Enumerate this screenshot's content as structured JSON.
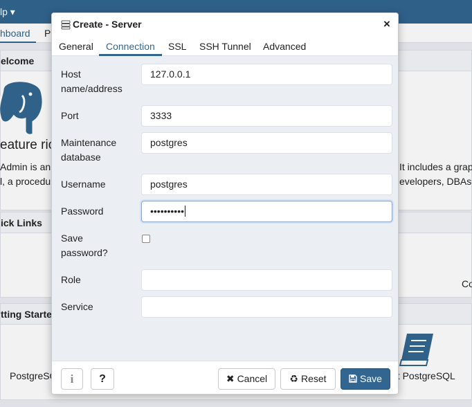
{
  "background": {
    "menu_label": "lp",
    "menu_chevron_icon": "chevron-down-icon",
    "tab_active": "hboard",
    "tab_other": "Pr",
    "welcome_head": "elcome",
    "feature_text": "eature ric",
    "admin_text_left": "Admin is an",
    "procedure_text_left": "l, a procedu",
    "includes_text_right": "It includes a grap",
    "developers_text_right": "evelopers, DBAs a",
    "quick_links_head": "ick Links",
    "co_text": "Co",
    "getting_started_head": "tting Started",
    "postgresql_left": "PostgreSQ",
    "postgresql_right": "et PostgreSQL",
    "elephant_icon": "postgres-elephant-logo",
    "book_icon": "book-icon"
  },
  "dialog": {
    "title": "Create - Server",
    "title_icon": "server-icon",
    "close_glyph": "×",
    "tabs": [
      {
        "label": "General",
        "active": false
      },
      {
        "label": "Connection",
        "active": true
      },
      {
        "label": "SSL",
        "active": false
      },
      {
        "label": "SSH Tunnel",
        "active": false
      },
      {
        "label": "Advanced",
        "active": false
      }
    ],
    "fields": {
      "host": {
        "label": "Host name/address",
        "value": "127.0.0.1"
      },
      "port": {
        "label": "Port",
        "value": "3333"
      },
      "maintenance_db": {
        "label": "Maintenance database",
        "value": "postgres"
      },
      "username": {
        "label": "Username",
        "value": "postgres"
      },
      "password": {
        "label": "Password",
        "value": "••••••••••"
      },
      "save_password": {
        "label": "Save password?",
        "checked": false
      },
      "role": {
        "label": "Role",
        "value": ""
      },
      "service": {
        "label": "Service",
        "value": ""
      }
    },
    "footer": {
      "info_label": "i",
      "help_label": "?",
      "cancel_label": "Cancel",
      "cancel_icon": "close-icon",
      "reset_label": "Reset",
      "reset_icon": "recycle-icon",
      "save_label": "Save",
      "save_icon": "floppy-disk-icon"
    }
  },
  "colors": {
    "accent": "#326690",
    "body_bg": "#ebeef3"
  }
}
